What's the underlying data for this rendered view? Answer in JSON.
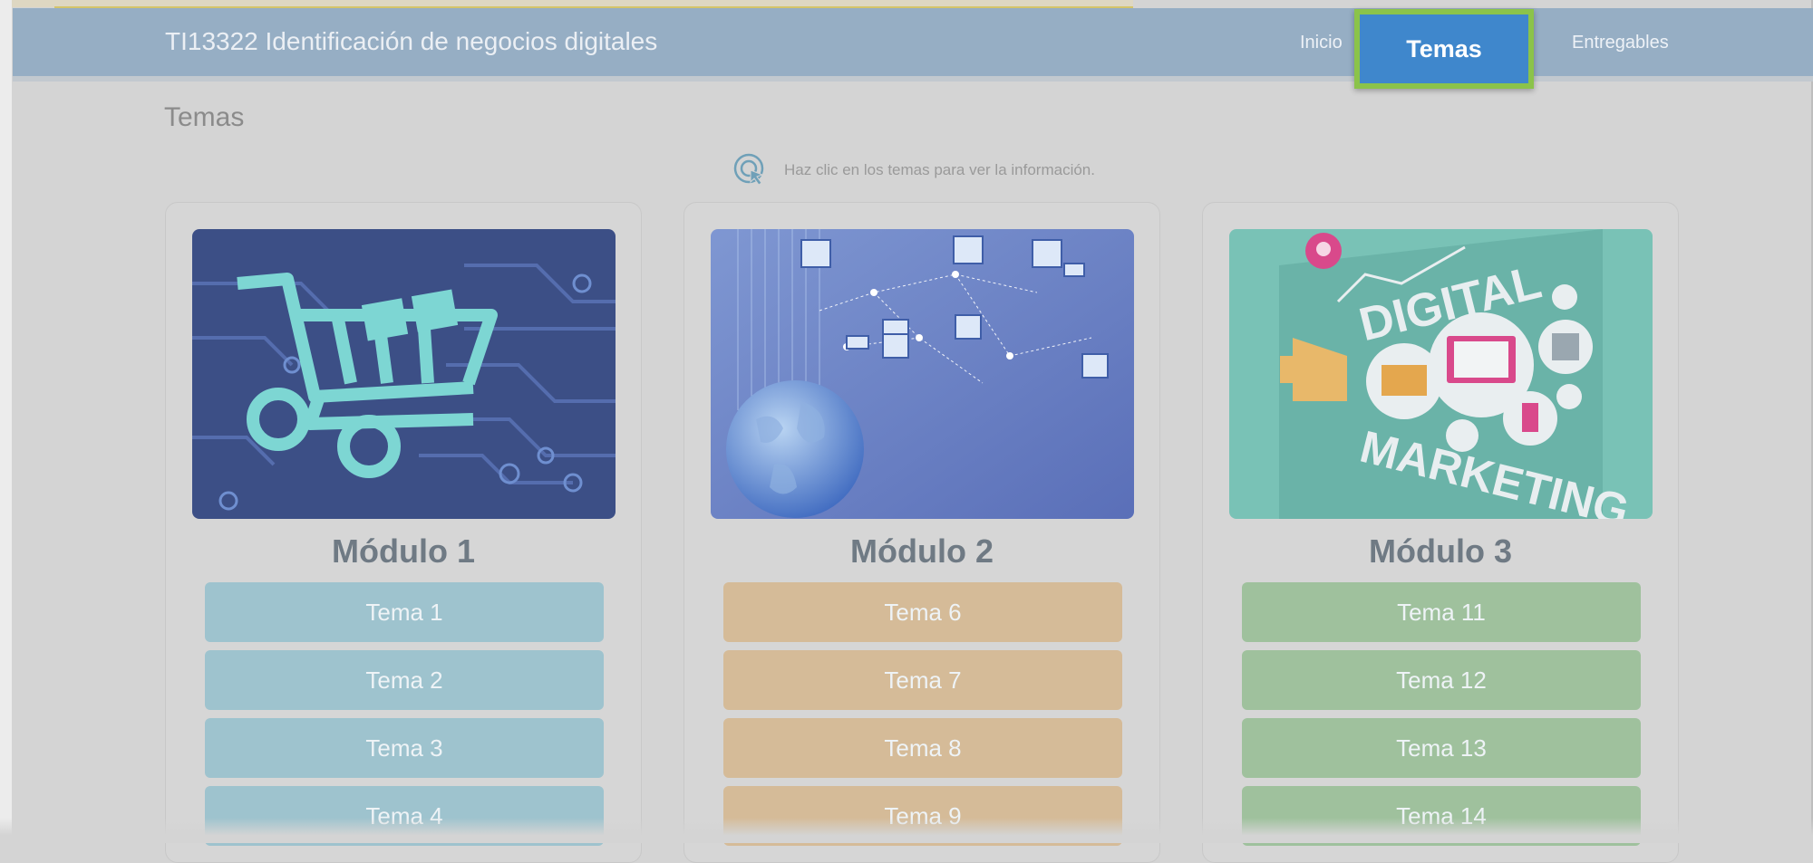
{
  "header": {
    "site_title": "TI13322 Identificación de negocios digitales",
    "nav": {
      "inicio": "Inicio",
      "temas": "Temas",
      "entregables": "Entregables"
    }
  },
  "page": {
    "heading": "Temas",
    "hint": "Haz clic en los temas para ver la información."
  },
  "modules": [
    {
      "title": "Módulo 1",
      "topics": [
        "Tema 1",
        "Tema 2",
        "Tema 3",
        "Tema 4"
      ],
      "image_icon": "shopping-cart-circuit-image"
    },
    {
      "title": "Módulo 2",
      "topics": [
        "Tema 6",
        "Tema 7",
        "Tema 8",
        "Tema 9"
      ],
      "image_icon": "globe-network-image"
    },
    {
      "title": "Módulo 3",
      "topics": [
        "Tema 11",
        "Tema 12",
        "Tema 13",
        "Tema 14"
      ],
      "image_icon": "digital-marketing-image",
      "image_text": [
        "DIGITAL",
        "MARKETING"
      ]
    }
  ],
  "colors": {
    "header_bg": "#96aec4",
    "active_tab": "#3f87cc",
    "active_tab_border": "#8bc34a",
    "module1_topic": "#9ec3ce",
    "module2_topic": "#d5bb98",
    "module3_topic": "#9fc19d"
  }
}
